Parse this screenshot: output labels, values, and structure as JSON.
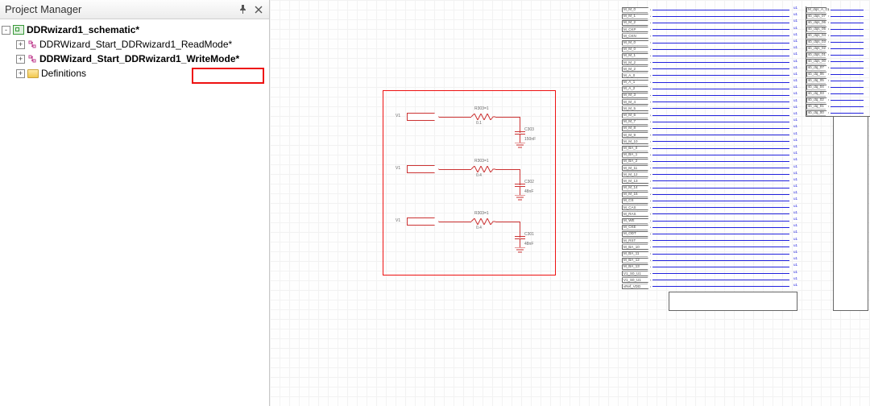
{
  "panel": {
    "title": "Project Manager"
  },
  "tree": {
    "root": {
      "label": "DDRwizard1_schematic*",
      "expander": "-"
    },
    "items": [
      {
        "label": "DDRWizard_Start_DDRwizard1_ReadMode*",
        "bold": false
      },
      {
        "label": "DDRWizard_Start_DDRwizard1_WriteMode*",
        "bold": true
      },
      {
        "label": "Definitions",
        "bold": false,
        "folder": true
      }
    ]
  },
  "circuits": [
    {
      "src": "V1",
      "r": "R303=1",
      "rv": "0.1",
      "c": "C303",
      "cv": "150nF"
    },
    {
      "src": "V1",
      "r": "R303=1",
      "rv": "0.4",
      "c": "C302",
      "cv": "48nF"
    },
    {
      "src": "V1",
      "r": "R303=1",
      "rv": "0.4",
      "c": "C301",
      "cv": "48nF"
    }
  ],
  "pins_left": [
    "M_M_0",
    "M_M_1",
    "M_M_2",
    "M_CKP",
    "M_CKN",
    "M_M_0",
    "M_M_0",
    "M_M_1",
    "M_M_2",
    "M_M_2",
    "M_A_0",
    "M_A_1",
    "M_A_2",
    "M_M_3",
    "M_M_4",
    "M_M_5",
    "M_M_6",
    "M_M_7",
    "M_M_8",
    "M_M_9",
    "M_M_10",
    "M_BA_0",
    "M_BA_1",
    "M_BA_2",
    "M_M_11",
    "M_M_12",
    "M_M_13",
    "M_M_14",
    "M_M_15",
    "M_CS",
    "M_CAS",
    "M_RAS",
    "M_WE",
    "M_CKE",
    "M_ODT",
    "M_RST",
    "M_BA_10",
    "M_BA_11",
    "M_BA_12",
    "M_BA_13",
    "V1_S0_U1",
    "V1_S0_U1",
    "vRef_VDD"
  ],
  "pins_left_end": "u1",
  "pins_right": [
    "M_dqs_A_01",
    "sb_dqs_07",
    "sb_dqs_06",
    "sb_dqs_05",
    "sb_dqs_04",
    "sb_dqs_03",
    "sb_dqs_02",
    "sb_dqs_01",
    "sb_dqs_00",
    "sb_dq_07",
    "sb_dq_06",
    "sb_dq_05",
    "sb_dq_04",
    "sb_dq_03",
    "sb_dq_02",
    "sb_dq_01",
    "sb_dq_00"
  ]
}
